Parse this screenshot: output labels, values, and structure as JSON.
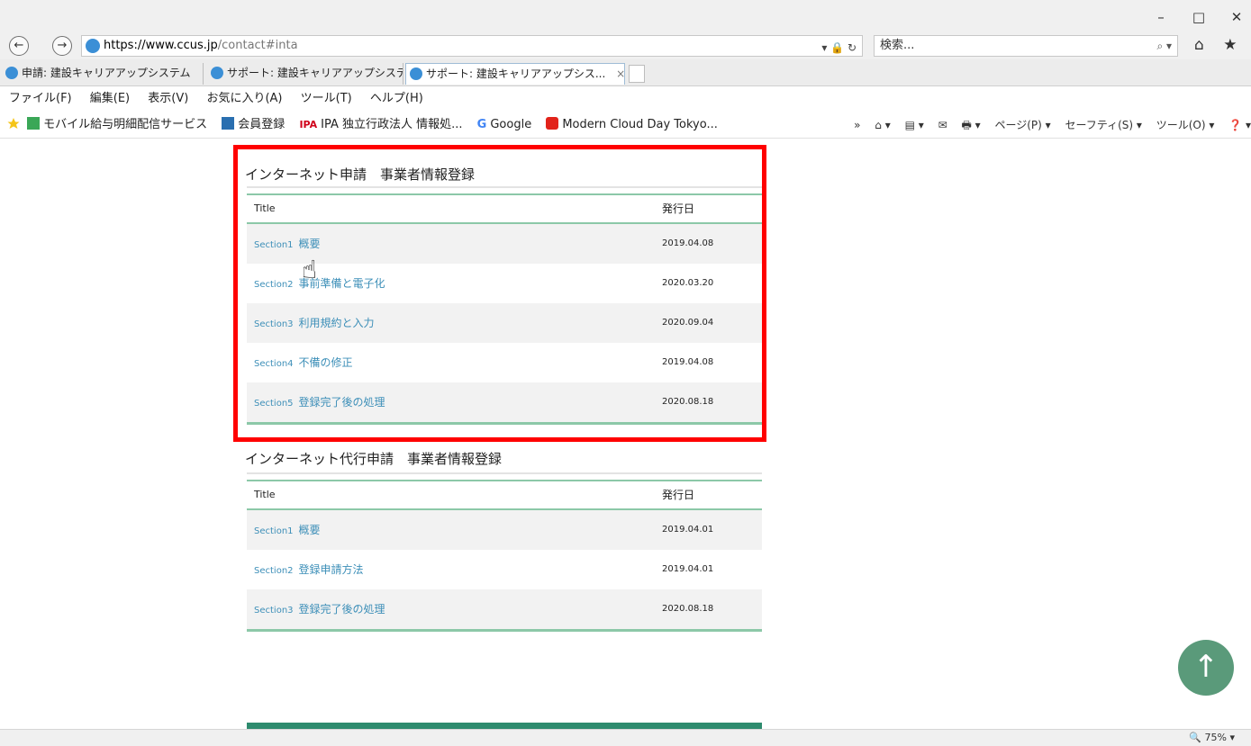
{
  "window": {
    "minimize": "–",
    "maximize": "□",
    "close": "✕"
  },
  "nav": {
    "back": "←",
    "forward": "→"
  },
  "address": {
    "host": "https://www.ccus.jp",
    "path": "/contact#inta",
    "controls": "▾ 🔒 ↻"
  },
  "search": {
    "placeholder": "検索...",
    "icon": "⌕ ▾"
  },
  "toolbar_icons": "⌂ ★",
  "tabs": [
    {
      "label": "申請: 建設キャリアアップシステム"
    },
    {
      "label": "サポート: 建設キャリアアップシステム"
    },
    {
      "label": "サポート: 建設キャリアアップシス...",
      "close": "×"
    }
  ],
  "menu": [
    "ファイル(F)",
    "編集(E)",
    "表示(V)",
    "お気に入り(A)",
    "ツール(T)",
    "ヘルプ(H)"
  ],
  "favorites": [
    {
      "label": "モバイル給与明細配信サービス"
    },
    {
      "label": "会員登録"
    },
    {
      "label": "IPA 独立行政法人 情報処..."
    },
    {
      "label": "Google"
    },
    {
      "label": "Modern Cloud Day Tokyo..."
    }
  ],
  "commandbar": {
    "chevron": "»",
    "items": [
      "⌂ ▾",
      "▤ ▾",
      "✉",
      "🖶 ▾",
      "ページ(P) ▾",
      "セーフティ(S) ▾",
      "ツール(O) ▾",
      "❓ ▾"
    ]
  },
  "main": {
    "section1": {
      "title": "インターネット申請　事業者情報登録",
      "header": {
        "title": "Title",
        "date": "発行日"
      },
      "rows": [
        {
          "sec": "Section1",
          "name": "概要",
          "date": "2019.04.08"
        },
        {
          "sec": "Section2",
          "name": "事前準備と電子化",
          "date": "2020.03.20"
        },
        {
          "sec": "Section3",
          "name": "利用規約と入力",
          "date": "2020.09.04"
        },
        {
          "sec": "Section4",
          "name": "不備の修正",
          "date": "2019.04.08"
        },
        {
          "sec": "Section5",
          "name": "登録完了後の処理",
          "date": "2020.08.18"
        }
      ]
    },
    "section2": {
      "title": "インターネット代行申請　事業者情報登録",
      "header": {
        "title": "Title",
        "date": "発行日"
      },
      "rows": [
        {
          "sec": "Section1",
          "name": "概要",
          "date": "2019.04.01"
        },
        {
          "sec": "Section2",
          "name": "登録申請方法",
          "date": "2019.04.01"
        },
        {
          "sec": "Section3",
          "name": "登録完了後の処理",
          "date": "2020.08.18"
        }
      ]
    },
    "to_top": "↑"
  },
  "status": {
    "zoom": "🔍 75%",
    "zoom_arrow": "▾"
  },
  "colors": {
    "accent_green": "#8cc8a8",
    "link_blue": "#3d8fb8",
    "highlight_red": "#ff0000",
    "footer_green": "#2e8b6e"
  }
}
